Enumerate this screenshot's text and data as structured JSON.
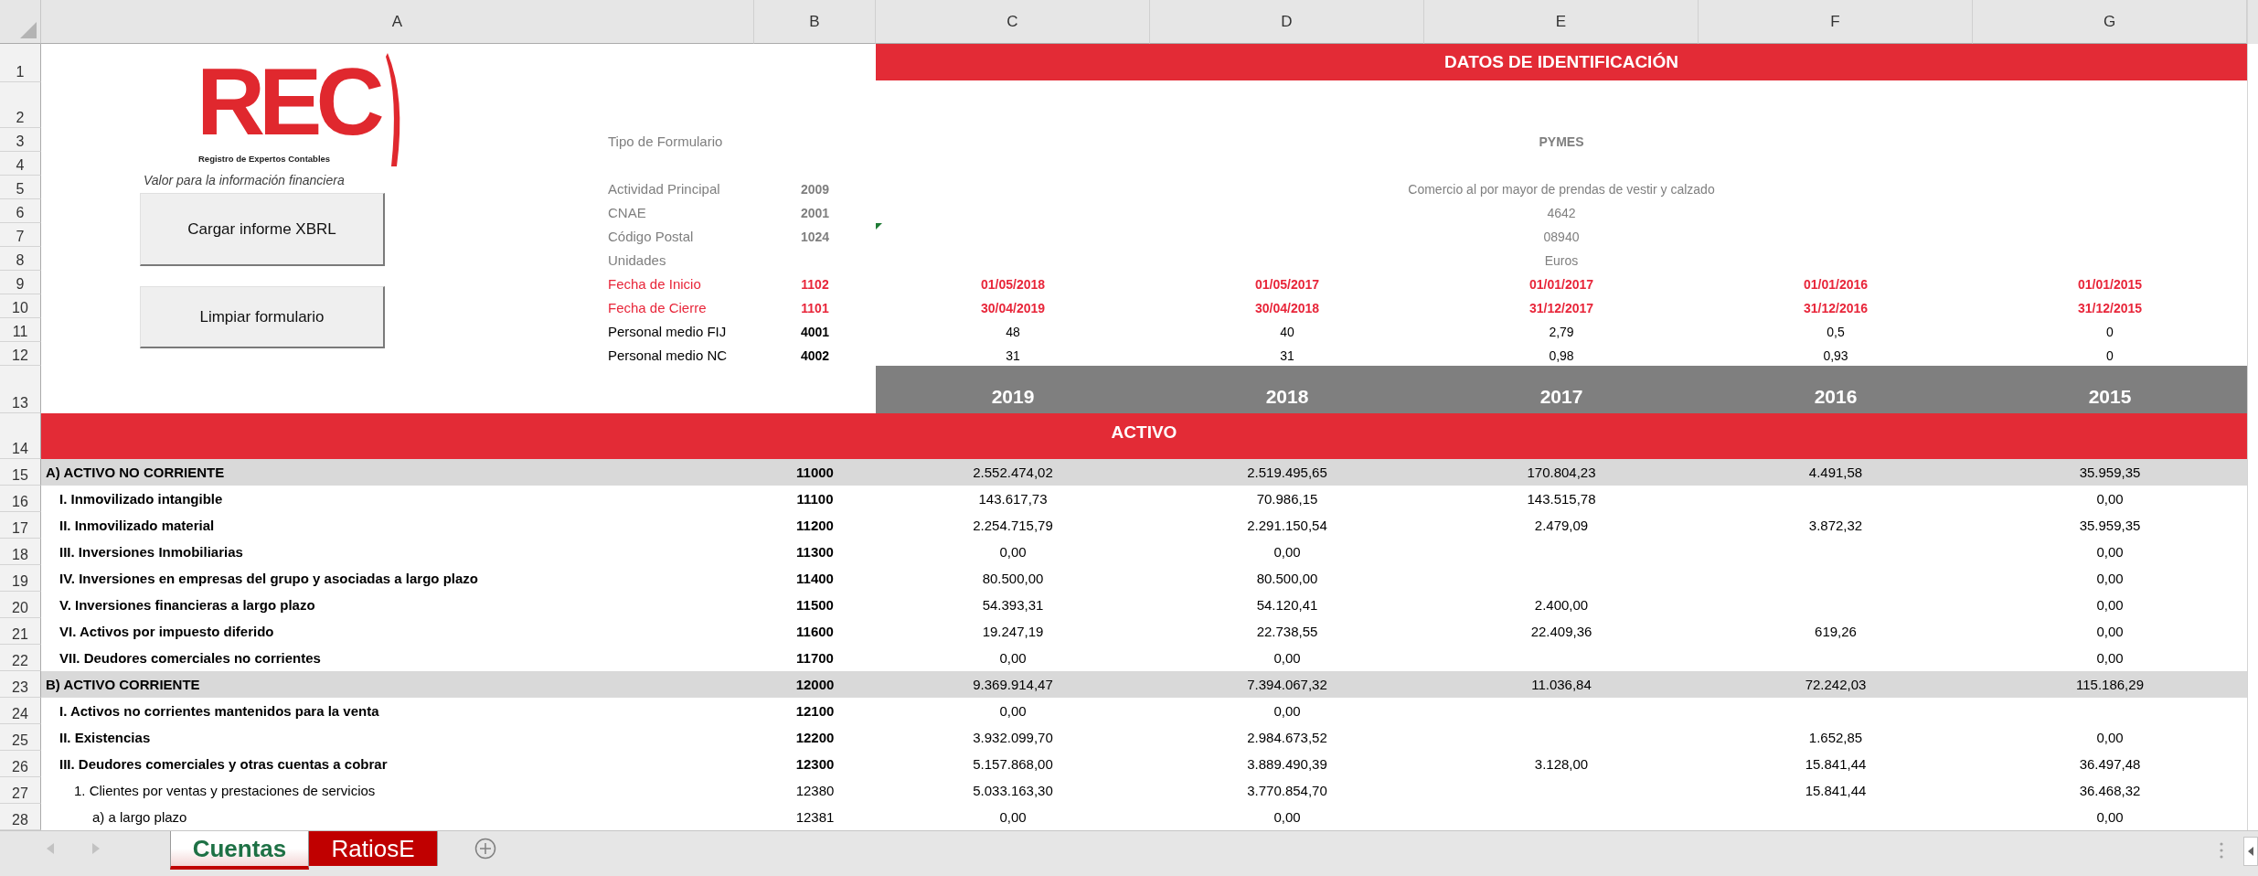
{
  "column_headers": [
    "A",
    "B",
    "C",
    "D",
    "E",
    "F",
    "G"
  ],
  "row_numbers": [
    "1",
    "2",
    "3",
    "4",
    "5",
    "6",
    "7",
    "8",
    "9",
    "10",
    "11",
    "12",
    "13",
    "14",
    "15",
    "16",
    "17",
    "18",
    "19",
    "20",
    "21",
    "22",
    "23",
    "24",
    "25",
    "26",
    "27",
    "28"
  ],
  "logo": {
    "text": "REC",
    "subtitle": "Registro de Expertos Contables",
    "tagline": "Valor para la información financiera"
  },
  "buttons": [
    "Cargar informe XBRL",
    "Limpiar formulario"
  ],
  "identification": {
    "title": "DATOS DE IDENTIFICACIÓN",
    "fields": [
      {
        "kind": "form_type",
        "label": "Tipo de Formulario",
        "value": "PYMES"
      },
      {
        "kind": "general",
        "label": "Actividad Principal",
        "code": "2009",
        "value": "Comercio al por mayor de prendas de vestir y calzado"
      },
      {
        "kind": "general",
        "label": "CNAE",
        "code": "2001",
        "value": "4642"
      },
      {
        "kind": "general",
        "label": "Código Postal",
        "code": "1024",
        "value": "08940",
        "error_flag": true
      },
      {
        "kind": "general",
        "label": "Unidades",
        "value": "Euros"
      },
      {
        "kind": "date",
        "label": "Fecha de Inicio",
        "code": "1102",
        "values": [
          "01/05/2018",
          "01/05/2017",
          "01/01/2017",
          "01/01/2016",
          "01/01/2015"
        ]
      },
      {
        "kind": "date",
        "label": "Fecha de Cierre",
        "code": "1101",
        "values": [
          "30/04/2019",
          "30/04/2018",
          "31/12/2017",
          "31/12/2016",
          "31/12/2015"
        ]
      },
      {
        "kind": "staff",
        "label": "Personal medio FIJ",
        "code": "4001",
        "values": [
          "48",
          "40",
          "2,79",
          "0,5",
          "0"
        ]
      },
      {
        "kind": "staff",
        "label": "Personal medio NC",
        "code": "4002",
        "values": [
          "31",
          "31",
          "0,98",
          "0,93",
          "0"
        ]
      }
    ]
  },
  "years": [
    "2019",
    "2018",
    "2017",
    "2016",
    "2015"
  ],
  "balance": {
    "title": "ACTIVO",
    "rows": [
      {
        "kind": "total",
        "label": "A) ACTIVO NO CORRIENTE",
        "code": "11000",
        "cells": {
          "c": "2.552.474,02",
          "d": "2.519.495,65",
          "e": "170.804,23",
          "f": "4.491,58",
          "g": "35.959,35"
        }
      },
      {
        "kind": "item",
        "label": "I. Inmovilizado intangible",
        "code": "11100",
        "cells": {
          "c": "143.617,73",
          "d": "70.986,15",
          "e": "143.515,78",
          "g": "0,00"
        }
      },
      {
        "kind": "item",
        "label": "II. Inmovilizado material",
        "code": "11200",
        "cells": {
          "c": "2.254.715,79",
          "d": "2.291.150,54",
          "e": "2.479,09",
          "f": "3.872,32",
          "g": "35.959,35"
        }
      },
      {
        "kind": "item",
        "label": "III. Inversiones Inmobiliarias",
        "code": "11300",
        "cells": {
          "c": "0,00",
          "d": "0,00",
          "g": "0,00"
        }
      },
      {
        "kind": "item",
        "label": "IV. Inversiones en empresas del grupo y asociadas a largo plazo",
        "code": "11400",
        "cells": {
          "c": "80.500,00",
          "d": "80.500,00",
          "g": "0,00"
        }
      },
      {
        "kind": "item",
        "label": "V. Inversiones financieras a largo plazo",
        "code": "11500",
        "cells": {
          "c": "54.393,31",
          "d": "54.120,41",
          "e": "2.400,00",
          "g": "0,00"
        }
      },
      {
        "kind": "item",
        "label": "VI. Activos por impuesto diferido",
        "code": "11600",
        "cells": {
          "c": "19.247,19",
          "d": "22.738,55",
          "e": "22.409,36",
          "f": "619,26",
          "g": "0,00"
        }
      },
      {
        "kind": "item",
        "label": "VII. Deudores comerciales no corrientes",
        "code": "11700",
        "cells": {
          "c": "0,00",
          "d": "0,00",
          "g": "0,00"
        }
      },
      {
        "kind": "total",
        "label": "B) ACTIVO CORRIENTE",
        "code": "12000",
        "cells": {
          "c": "9.369.914,47",
          "d": "7.394.067,32",
          "e": "11.036,84",
          "f": "72.242,03",
          "g": "115.186,29"
        }
      },
      {
        "kind": "item",
        "label": "I. Activos no corrientes mantenidos para la venta",
        "code": "12100",
        "cells": {
          "c": "0,00",
          "d": "0,00"
        }
      },
      {
        "kind": "item",
        "label": "II. Existencias",
        "code": "12200",
        "cells": {
          "c": "3.932.099,70",
          "d": "2.984.673,52",
          "f": "1.652,85",
          "g": "0,00"
        }
      },
      {
        "kind": "item",
        "label": "III. Deudores comerciales y otras cuentas a cobrar",
        "code": "12300",
        "cells": {
          "c": "5.157.868,00",
          "d": "3.889.490,39",
          "e": "3.128,00",
          "f": "15.841,44",
          "g": "36.497,48"
        }
      },
      {
        "kind": "subitem",
        "label": "1. Clientes por ventas y prestaciones de servicios",
        "code": "12380",
        "cells": {
          "c": "5.033.163,30",
          "d": "3.770.854,70",
          "f": "15.841,44",
          "g": "36.468,32"
        }
      },
      {
        "kind": "detail",
        "label": "a) a largo plazo",
        "code": "12381",
        "cells": {
          "c": "0,00",
          "d": "0,00",
          "g": "0,00"
        }
      }
    ]
  },
  "sheet_tabs": [
    {
      "label": "Cuentas",
      "selected": true,
      "color": "#c00000"
    },
    {
      "label": "RatiosE",
      "selected": false,
      "color": "#c00000"
    }
  ]
}
